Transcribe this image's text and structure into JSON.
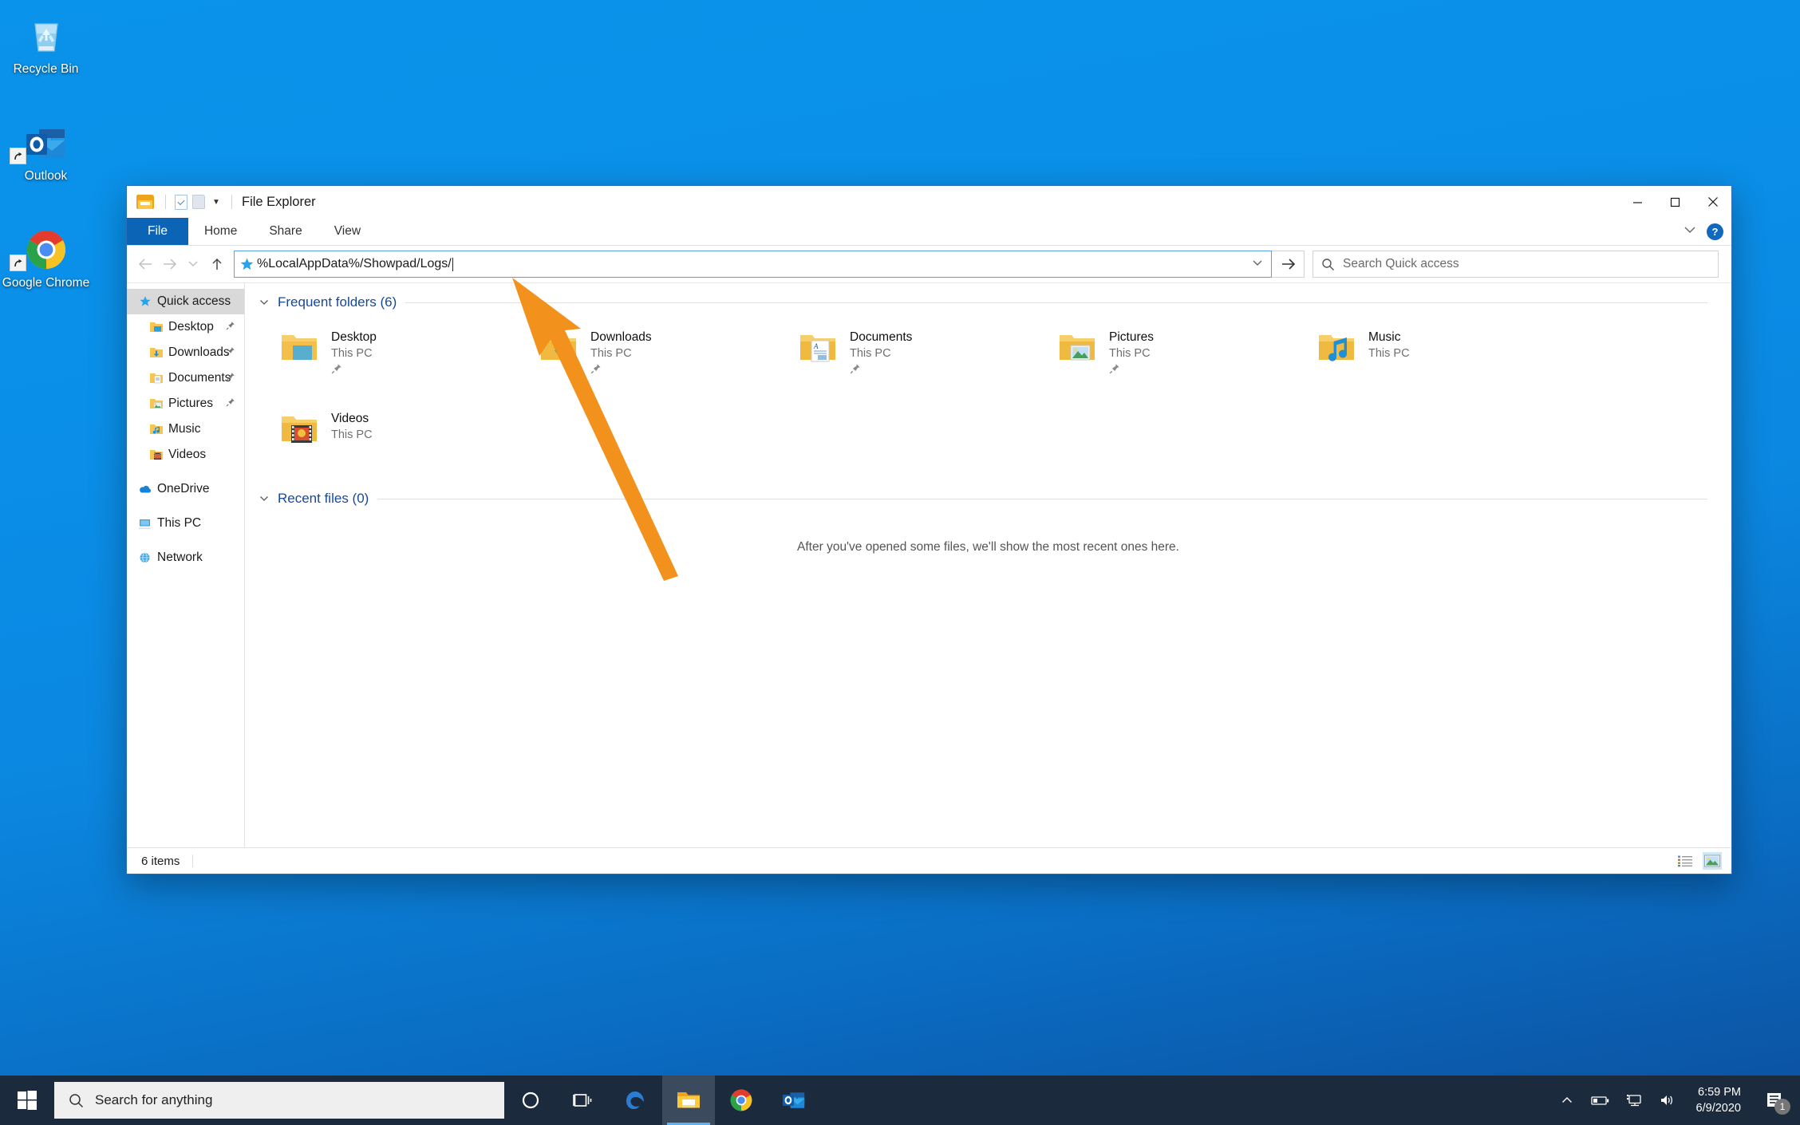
{
  "desktop": {
    "icons": [
      {
        "name": "Recycle Bin",
        "icon": "recycle-bin-icon",
        "shortcut": false
      },
      {
        "name": "Outlook",
        "icon": "outlook-icon",
        "shortcut": true
      },
      {
        "name": "Google Chrome",
        "icon": "chrome-icon",
        "shortcut": true
      }
    ]
  },
  "window": {
    "title": "File Explorer",
    "quick_access_toolbar": [
      "folder-icon",
      "properties-icon",
      "new-folder-icon",
      "customize-caret-icon"
    ],
    "controls": {
      "minimize": "–",
      "maximize": "□",
      "close": "✕"
    },
    "ribbon": {
      "tabs": [
        "File",
        "Home",
        "Share",
        "View"
      ],
      "active_tab": "File",
      "collapse_icon": "chevron-down-icon",
      "help_label": "?"
    },
    "address": {
      "value": "%LocalAppData%/Showpad/Logs/",
      "icon": "star-icon",
      "dropdown_icon": "chevron-down-icon",
      "go_icon": "→",
      "back_icon": "←",
      "forward_icon": "→",
      "recent_icon": "⌄",
      "up_icon": "↑"
    },
    "search": {
      "placeholder": "Search Quick access",
      "icon": "search-icon"
    },
    "status": {
      "items": "6 items",
      "view_details_icon": "details-view-icon",
      "view_large_icon": "large-icons-view-icon"
    }
  },
  "sidebar": {
    "items": [
      {
        "label": "Quick access",
        "icon": "star-icon",
        "selected": true,
        "child": false,
        "pinned": false
      },
      {
        "label": "Desktop",
        "icon": "desktop-folder-icon",
        "selected": false,
        "child": true,
        "pinned": true
      },
      {
        "label": "Downloads",
        "icon": "downloads-folder-icon",
        "selected": false,
        "child": true,
        "pinned": true
      },
      {
        "label": "Documents",
        "icon": "documents-folder-icon",
        "selected": false,
        "child": true,
        "pinned": true
      },
      {
        "label": "Pictures",
        "icon": "pictures-folder-icon",
        "selected": false,
        "child": true,
        "pinned": true
      },
      {
        "label": "Music",
        "icon": "music-folder-icon",
        "selected": false,
        "child": true,
        "pinned": false
      },
      {
        "label": "Videos",
        "icon": "videos-folder-icon",
        "selected": false,
        "child": true,
        "pinned": false
      },
      {
        "label": "OneDrive",
        "icon": "onedrive-icon",
        "selected": false,
        "child": false,
        "pinned": false
      },
      {
        "label": "This PC",
        "icon": "this-pc-icon",
        "selected": false,
        "child": false,
        "pinned": false
      },
      {
        "label": "Network",
        "icon": "network-icon",
        "selected": false,
        "child": false,
        "pinned": false
      }
    ]
  },
  "main": {
    "frequent_folders": {
      "title": "Frequent folders (6)",
      "chevron": "⌄",
      "items": [
        {
          "name": "Desktop",
          "location": "This PC",
          "icon": "desktop-folder-icon",
          "pinned": true
        },
        {
          "name": "Downloads",
          "location": "This PC",
          "icon": "downloads-folder-icon",
          "pinned": true
        },
        {
          "name": "Documents",
          "location": "This PC",
          "icon": "documents-folder-icon",
          "pinned": true
        },
        {
          "name": "Pictures",
          "location": "This PC",
          "icon": "pictures-folder-icon",
          "pinned": true
        },
        {
          "name": "Music",
          "location": "This PC",
          "icon": "music-folder-icon",
          "pinned": false
        },
        {
          "name": "Videos",
          "location": "This PC",
          "icon": "videos-folder-icon",
          "pinned": false
        }
      ]
    },
    "recent_files": {
      "title": "Recent files (0)",
      "chevron": "⌄",
      "empty_message": "After you've opened some files, we'll show the most recent ones here."
    }
  },
  "annotation": {
    "type": "arrow",
    "color": "#f2921d",
    "points_to": "address-bar"
  },
  "taskbar": {
    "start_icon": "windows-logo-icon",
    "search": {
      "placeholder": "Search for anything",
      "icon": "search-icon"
    },
    "buttons": [
      {
        "name": "cortana-icon"
      },
      {
        "name": "task-view-icon"
      },
      {
        "name": "edge-icon"
      },
      {
        "name": "file-explorer-icon"
      },
      {
        "name": "chrome-icon"
      },
      {
        "name": "outlook-icon"
      }
    ],
    "tray": {
      "expand_icon": "chevron-up-icon",
      "icons": [
        "battery-icon",
        "network-icon",
        "volume-icon"
      ],
      "time": "6:59 PM",
      "date": "6/9/2020",
      "notifications_icon": "action-center-icon",
      "notification_count": "1"
    }
  },
  "colors": {
    "accent": "#0b64b5",
    "link": "#16499c",
    "annotation": "#f2921d",
    "taskbar": "#1b2a3d",
    "desktop_top": "#0a93ea"
  }
}
